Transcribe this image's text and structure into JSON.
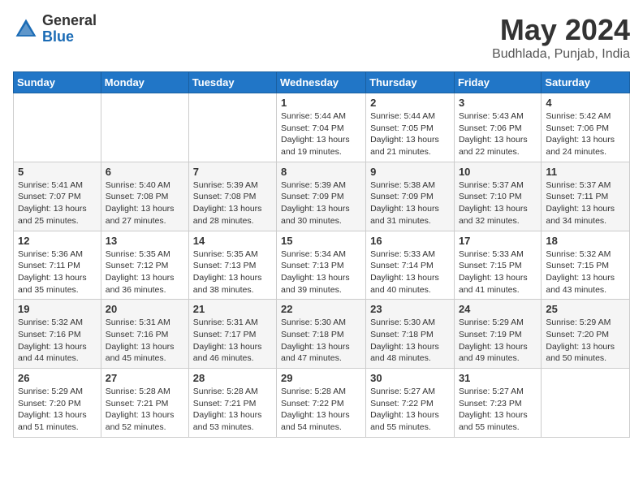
{
  "header": {
    "logo_general": "General",
    "logo_blue": "Blue",
    "month_title": "May 2024",
    "location": "Budhlada, Punjab, India"
  },
  "weekdays": [
    "Sunday",
    "Monday",
    "Tuesday",
    "Wednesday",
    "Thursday",
    "Friday",
    "Saturday"
  ],
  "weeks": [
    [
      {
        "day": "",
        "info": ""
      },
      {
        "day": "",
        "info": ""
      },
      {
        "day": "",
        "info": ""
      },
      {
        "day": "1",
        "info": "Sunrise: 5:44 AM\nSunset: 7:04 PM\nDaylight: 13 hours\nand 19 minutes."
      },
      {
        "day": "2",
        "info": "Sunrise: 5:44 AM\nSunset: 7:05 PM\nDaylight: 13 hours\nand 21 minutes."
      },
      {
        "day": "3",
        "info": "Sunrise: 5:43 AM\nSunset: 7:06 PM\nDaylight: 13 hours\nand 22 minutes."
      },
      {
        "day": "4",
        "info": "Sunrise: 5:42 AM\nSunset: 7:06 PM\nDaylight: 13 hours\nand 24 minutes."
      }
    ],
    [
      {
        "day": "5",
        "info": "Sunrise: 5:41 AM\nSunset: 7:07 PM\nDaylight: 13 hours\nand 25 minutes."
      },
      {
        "day": "6",
        "info": "Sunrise: 5:40 AM\nSunset: 7:08 PM\nDaylight: 13 hours\nand 27 minutes."
      },
      {
        "day": "7",
        "info": "Sunrise: 5:39 AM\nSunset: 7:08 PM\nDaylight: 13 hours\nand 28 minutes."
      },
      {
        "day": "8",
        "info": "Sunrise: 5:39 AM\nSunset: 7:09 PM\nDaylight: 13 hours\nand 30 minutes."
      },
      {
        "day": "9",
        "info": "Sunrise: 5:38 AM\nSunset: 7:09 PM\nDaylight: 13 hours\nand 31 minutes."
      },
      {
        "day": "10",
        "info": "Sunrise: 5:37 AM\nSunset: 7:10 PM\nDaylight: 13 hours\nand 32 minutes."
      },
      {
        "day": "11",
        "info": "Sunrise: 5:37 AM\nSunset: 7:11 PM\nDaylight: 13 hours\nand 34 minutes."
      }
    ],
    [
      {
        "day": "12",
        "info": "Sunrise: 5:36 AM\nSunset: 7:11 PM\nDaylight: 13 hours\nand 35 minutes."
      },
      {
        "day": "13",
        "info": "Sunrise: 5:35 AM\nSunset: 7:12 PM\nDaylight: 13 hours\nand 36 minutes."
      },
      {
        "day": "14",
        "info": "Sunrise: 5:35 AM\nSunset: 7:13 PM\nDaylight: 13 hours\nand 38 minutes."
      },
      {
        "day": "15",
        "info": "Sunrise: 5:34 AM\nSunset: 7:13 PM\nDaylight: 13 hours\nand 39 minutes."
      },
      {
        "day": "16",
        "info": "Sunrise: 5:33 AM\nSunset: 7:14 PM\nDaylight: 13 hours\nand 40 minutes."
      },
      {
        "day": "17",
        "info": "Sunrise: 5:33 AM\nSunset: 7:15 PM\nDaylight: 13 hours\nand 41 minutes."
      },
      {
        "day": "18",
        "info": "Sunrise: 5:32 AM\nSunset: 7:15 PM\nDaylight: 13 hours\nand 43 minutes."
      }
    ],
    [
      {
        "day": "19",
        "info": "Sunrise: 5:32 AM\nSunset: 7:16 PM\nDaylight: 13 hours\nand 44 minutes."
      },
      {
        "day": "20",
        "info": "Sunrise: 5:31 AM\nSunset: 7:16 PM\nDaylight: 13 hours\nand 45 minutes."
      },
      {
        "day": "21",
        "info": "Sunrise: 5:31 AM\nSunset: 7:17 PM\nDaylight: 13 hours\nand 46 minutes."
      },
      {
        "day": "22",
        "info": "Sunrise: 5:30 AM\nSunset: 7:18 PM\nDaylight: 13 hours\nand 47 minutes."
      },
      {
        "day": "23",
        "info": "Sunrise: 5:30 AM\nSunset: 7:18 PM\nDaylight: 13 hours\nand 48 minutes."
      },
      {
        "day": "24",
        "info": "Sunrise: 5:29 AM\nSunset: 7:19 PM\nDaylight: 13 hours\nand 49 minutes."
      },
      {
        "day": "25",
        "info": "Sunrise: 5:29 AM\nSunset: 7:20 PM\nDaylight: 13 hours\nand 50 minutes."
      }
    ],
    [
      {
        "day": "26",
        "info": "Sunrise: 5:29 AM\nSunset: 7:20 PM\nDaylight: 13 hours\nand 51 minutes."
      },
      {
        "day": "27",
        "info": "Sunrise: 5:28 AM\nSunset: 7:21 PM\nDaylight: 13 hours\nand 52 minutes."
      },
      {
        "day": "28",
        "info": "Sunrise: 5:28 AM\nSunset: 7:21 PM\nDaylight: 13 hours\nand 53 minutes."
      },
      {
        "day": "29",
        "info": "Sunrise: 5:28 AM\nSunset: 7:22 PM\nDaylight: 13 hours\nand 54 minutes."
      },
      {
        "day": "30",
        "info": "Sunrise: 5:27 AM\nSunset: 7:22 PM\nDaylight: 13 hours\nand 55 minutes."
      },
      {
        "day": "31",
        "info": "Sunrise: 5:27 AM\nSunset: 7:23 PM\nDaylight: 13 hours\nand 55 minutes."
      },
      {
        "day": "",
        "info": ""
      }
    ]
  ]
}
